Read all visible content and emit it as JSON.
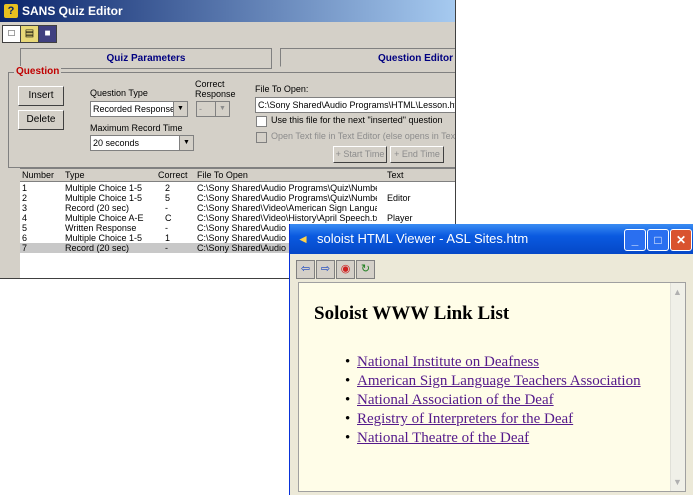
{
  "quiz_editor": {
    "title": "SANS Quiz Editor",
    "tabs": [
      "Quiz Parameters",
      "Question Editor"
    ],
    "question_group": "Question",
    "buttons": {
      "insert": "Insert",
      "delete": "Delete",
      "start_time": "+ Start Time",
      "end_time": "+ End Time"
    },
    "question_type_label": "Question Type",
    "question_type_value": "Recorded Response",
    "correct_response_label_1": "Correct",
    "correct_response_label_2": "Response",
    "correct_response_value": "-",
    "max_record_label": "Maximum Record Time",
    "max_record_value": "20 seconds",
    "file_label": "File To Open:",
    "file_value": "C:\\Sony Shared\\Audio Programs\\HTML\\Lesson.htm",
    "check_next": "Use this file for the next \"inserted\" question",
    "check_text_editor": "Open Text file in Text Editor (else opens in Text F",
    "columns": [
      "Number",
      "Type",
      "Correct",
      "File To Open",
      "Text"
    ],
    "rows": [
      {
        "number": "1",
        "type": "Multiple Choice 1-5",
        "correct": "2",
        "file": "C:\\Sony Shared\\Audio Programs\\Quiz\\Numbers\\Qu...",
        "text": ""
      },
      {
        "number": "2",
        "type": "Multiple Choice 1-5",
        "correct": "5",
        "file": "C:\\Sony Shared\\Audio Programs\\Quiz\\Numbers\\Qu...",
        "text": "Editor"
      },
      {
        "number": "3",
        "type": "Record (20 sec)",
        "correct": "-",
        "file": "C:\\Sony Shared\\Video\\American Sign Language\\St...",
        "text": ""
      },
      {
        "number": "4",
        "type": "Multiple Choice A-E",
        "correct": "C",
        "file": "C:\\Sony Shared\\Video\\History\\April Speech.txt",
        "text": "Player"
      },
      {
        "number": "5",
        "type": "Written Response",
        "correct": "-",
        "file": "C:\\Sony Shared\\Audio P",
        "text": ""
      },
      {
        "number": "6",
        "type": "Multiple Choice 1-5",
        "correct": "1",
        "file": "C:\\Sony Shared\\Audio P",
        "text": ""
      },
      {
        "number": "7",
        "type": "Record (20 sec)",
        "correct": "-",
        "file": "C:\\Sony Shared\\Audio P",
        "text": ""
      }
    ]
  },
  "viewer": {
    "title": "soloist HTML Viewer - ASL Sites.htm",
    "heading": "Soloist WWW Link List",
    "links": [
      "National Institute on Deafness",
      "American Sign Language Teachers Association",
      "National Association of the Deaf",
      "Registry of Interpreters for the Deaf",
      "National Theatre of the Deaf"
    ],
    "link_color": "#551a8b",
    "page_background": "#fffde8"
  }
}
